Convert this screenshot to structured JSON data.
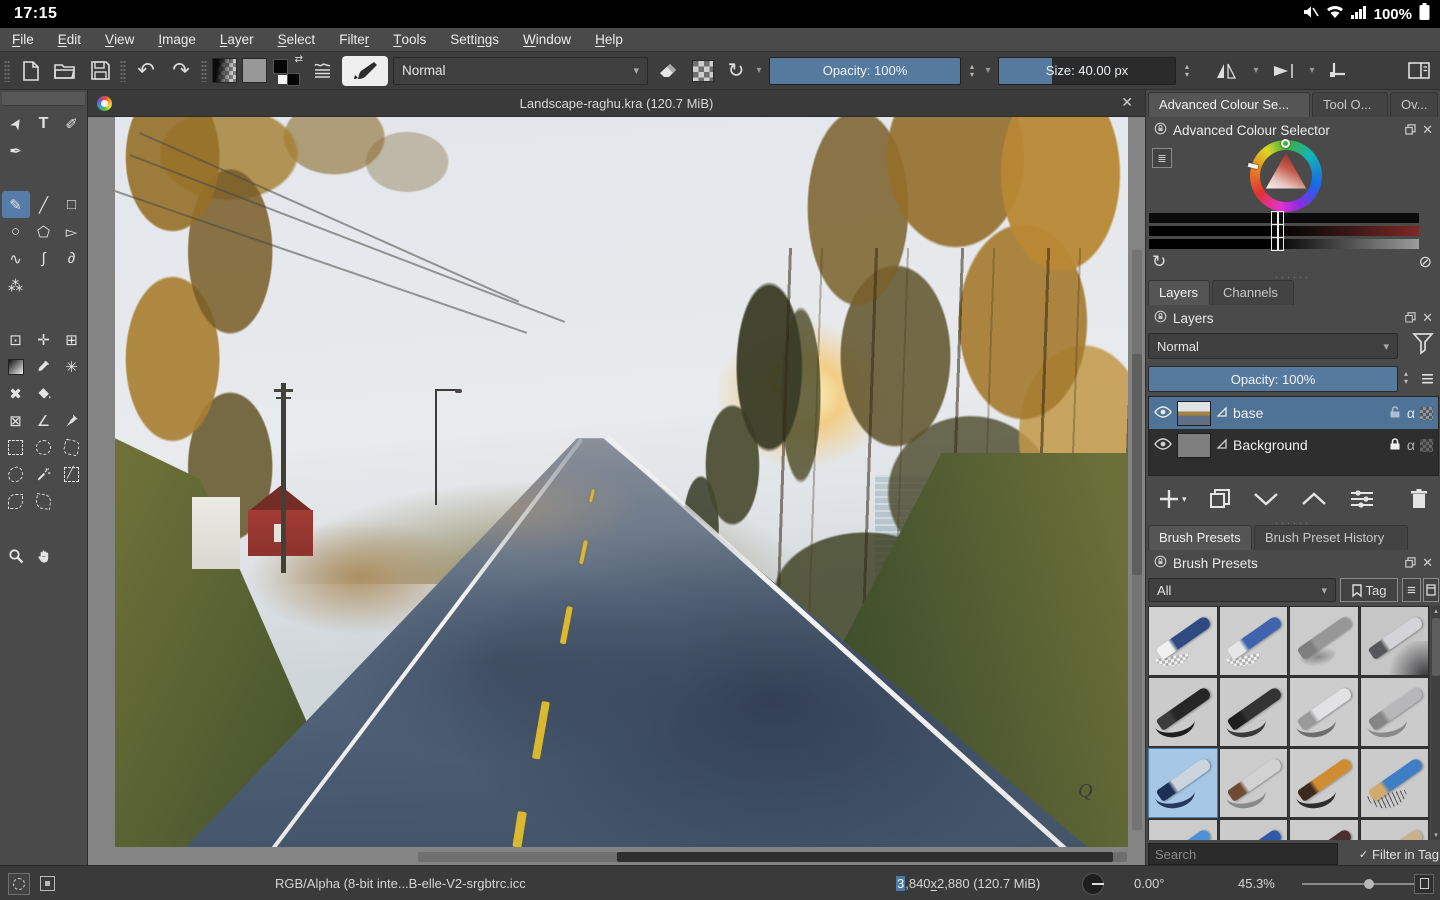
{
  "status_bar": {
    "time": "17:15",
    "battery": "100%"
  },
  "menu": {
    "items": [
      {
        "label": "File",
        "mnemonic": 0
      },
      {
        "label": "Edit",
        "mnemonic": 0
      },
      {
        "label": "View",
        "mnemonic": 0
      },
      {
        "label": "Image",
        "mnemonic": 0
      },
      {
        "label": "Layer",
        "mnemonic": 0
      },
      {
        "label": "Select",
        "mnemonic": 0
      },
      {
        "label": "Filter",
        "mnemonic": 5
      },
      {
        "label": "Tools",
        "mnemonic": 0
      },
      {
        "label": "Settings",
        "mnemonic": 5
      },
      {
        "label": "Window",
        "mnemonic": 0
      },
      {
        "label": "Help",
        "mnemonic": 0
      }
    ]
  },
  "toolbar": {
    "blending_mode": "Normal",
    "opacity_label": "Opacity: 100%",
    "opacity_fill": 1.0,
    "size_label": "Size: 40.00 px",
    "size_fill": 0.3
  },
  "document": {
    "title": "Landscape-raghu.kra (120.7 MiB)",
    "close": "✕",
    "signature": "Q"
  },
  "toolbox": {
    "tools": [
      {
        "name": "select-shapes-tool",
        "kind": "glyph",
        "glyph": "➤",
        "rot": -58
      },
      {
        "name": "text-tool",
        "kind": "glyph",
        "glyph": "T"
      },
      {
        "name": "edit-shapes-tool",
        "kind": "glyph",
        "glyph": "✐"
      },
      {
        "name": "calligraphy-tool",
        "kind": "glyph",
        "glyph": "✒"
      },
      {
        "kind": "blank"
      },
      {
        "kind": "blank"
      },
      {
        "kind": "gap"
      },
      {
        "name": "freehand-brush-tool",
        "kind": "glyph",
        "glyph": "✎",
        "selected": true
      },
      {
        "name": "line-tool",
        "kind": "glyph",
        "glyph": "╱"
      },
      {
        "name": "rectangle-tool",
        "kind": "glyph",
        "glyph": "□"
      },
      {
        "name": "ellipse-tool",
        "kind": "glyph",
        "glyph": "○"
      },
      {
        "name": "polygon-tool",
        "kind": "glyph",
        "glyph": "⬠"
      },
      {
        "name": "polyline-tool",
        "kind": "glyph",
        "glyph": "▻"
      },
      {
        "name": "bezier-curve-tool",
        "kind": "glyph",
        "glyph": "∿"
      },
      {
        "name": "freehand-path-tool",
        "kind": "glyph",
        "glyph": "∫"
      },
      {
        "name": "dynamic-brush-tool",
        "kind": "glyph",
        "glyph": "∂"
      },
      {
        "name": "multibrush-tool",
        "kind": "glyph",
        "glyph": "⁂"
      },
      {
        "kind": "blank"
      },
      {
        "kind": "blank"
      },
      {
        "kind": "gap"
      },
      {
        "name": "transform-tool",
        "kind": "glyph",
        "glyph": "⊡"
      },
      {
        "name": "move-tool",
        "kind": "glyph",
        "glyph": "✛"
      },
      {
        "name": "crop-tool",
        "kind": "glyph",
        "glyph": "⊞"
      },
      {
        "name": "gradient-tool",
        "kind": "css",
        "css": "tb-gradient"
      },
      {
        "name": "color-sampler-tool",
        "kind": "svg",
        "svg": "dropper"
      },
      {
        "name": "smart-patch-tool",
        "kind": "glyph",
        "glyph": "✳"
      },
      {
        "name": "colorize-mask-tool",
        "kind": "glyph",
        "glyph": "✖"
      },
      {
        "name": "fill-tool",
        "kind": "svg",
        "svg": "bucket"
      },
      {
        "kind": "blank"
      },
      {
        "name": "assistants-tool",
        "kind": "glyph",
        "glyph": "⊠"
      },
      {
        "name": "measure-tool",
        "kind": "glyph",
        "glyph": "∠"
      },
      {
        "name": "reference-images-tool",
        "kind": "svg",
        "svg": "pin"
      },
      {
        "name": "rectangular-selection-tool",
        "kind": "css",
        "css": "selicon"
      },
      {
        "name": "elliptical-selection-tool",
        "kind": "css",
        "css": "selicon sel-ellipse"
      },
      {
        "name": "polygonal-selection-tool",
        "kind": "css",
        "css": "selicon sel-poly"
      },
      {
        "name": "freehand-selection-tool",
        "kind": "css",
        "css": "selicon sel-outline"
      },
      {
        "name": "similar-color-selection-tool",
        "kind": "svg",
        "svg": "wand"
      },
      {
        "name": "enclose-fill-tool",
        "kind": "css",
        "css": "selicon sel-enclose"
      },
      {
        "name": "bezier-selection-tool",
        "kind": "css",
        "css": "selicon sel-bezier"
      },
      {
        "name": "magnetic-selection-tool",
        "kind": "css",
        "css": "selicon sel-magnetic"
      },
      {
        "kind": "blank"
      },
      {
        "kind": "gap"
      },
      {
        "name": "zoom-tool",
        "kind": "svg",
        "svg": "magnifier"
      },
      {
        "name": "pan-tool",
        "kind": "svg",
        "svg": "hand"
      }
    ]
  },
  "right_panel": {
    "dock_tabs": [
      {
        "label": "Advanced Colour Se...",
        "active": true
      },
      {
        "label": "Tool O...",
        "active": false
      },
      {
        "label": "Ov...",
        "active": false
      }
    ],
    "color_selector": {
      "title": "Advanced Colour Selector"
    },
    "layers": {
      "tabs": [
        {
          "label": "Layers",
          "active": true
        },
        {
          "label": "Channels",
          "active": false
        }
      ],
      "title": "Layers",
      "blending_mode": "Normal",
      "opacity_label": "Opacity:  100%",
      "rows": [
        {
          "name": "base",
          "selected": true,
          "locked": false
        },
        {
          "name": "Background",
          "selected": false,
          "locked": true
        }
      ]
    },
    "brush_presets": {
      "tabs": [
        {
          "label": "Brush Presets",
          "active": true
        },
        {
          "label": "Brush Preset History",
          "active": false
        }
      ],
      "title": "Brush Presets",
      "tag_filter": "All",
      "tag_button": "Tag",
      "search_placeholder": "Search",
      "filter_label": "Filter in Tag",
      "brushes": [
        {
          "name": "eraser-large",
          "cell": "#d2d2d2",
          "tip": "#f1f1f1",
          "handle": "#2e4a80",
          "stroke": "checker"
        },
        {
          "name": "eraser-small",
          "cell": "#cecece",
          "tip": "#e6e6e6",
          "handle": "#3f63ad",
          "stroke": "checker"
        },
        {
          "name": "blender-soft",
          "cell": "#cccccc",
          "tip": "#7e7e7e",
          "handle": "#979797",
          "stroke": "soft"
        },
        {
          "name": "airbrush-pen",
          "cell": "#c6c6c6",
          "tip": "#55565a",
          "handle": "#d4d4d8",
          "stroke": "shade"
        },
        {
          "name": "ink-pen-black",
          "cell": "#cbcbcb",
          "tip": "#3c3c3c",
          "handle": "#262626",
          "stroke": "#1d1d1d"
        },
        {
          "name": "marker-black",
          "cell": "#cbcbcb",
          "tip": "#1f1f1f",
          "handle": "#333333",
          "stroke": "#3a3a3a"
        },
        {
          "name": "fineliner-silver",
          "cell": "#cdcdcd",
          "tip": "#9a9a9a",
          "handle": "#e2e2e4",
          "stroke": "#6e6e6e"
        },
        {
          "name": "pen-gray",
          "cell": "#cbcbcb",
          "tip": "#858585",
          "handle": "#b7b7ba",
          "stroke": "#8a8a8a"
        },
        {
          "name": "paintbrush-wet",
          "cell": "#a6c8e6",
          "selected": true,
          "tip": "#1c2f55",
          "handle": "#ccd4de",
          "stroke": "#24385e"
        },
        {
          "name": "round-brush",
          "cell": "#cccccc",
          "tip": "#6e4b32",
          "handle": "#d2d2d2",
          "stroke": "#8a8a8a"
        },
        {
          "name": "dip-pen-orange",
          "cell": "#cdcdcd",
          "tip": "#3c2a1e",
          "handle": "#cf8c33",
          "stroke": "#2e2e2e"
        },
        {
          "name": "pencil-blue",
          "cell": "#cbcbcb",
          "tip": "#d2aa6e",
          "handle": "#3e7ec4",
          "stroke": "hatch"
        },
        {
          "name": "pencil-blue-2",
          "cell": "#cccccc",
          "tip": "#cfae78",
          "handle": "#4a90d9",
          "stroke": "#888888"
        },
        {
          "name": "pen-blue",
          "cell": "#cbcbcb",
          "tip": "#cccccc",
          "handle": "#2d59a8",
          "stroke": "#444444"
        },
        {
          "name": "marker-dark-red",
          "cell": "#cccccc",
          "tip": "#202020",
          "handle": "#4a3034",
          "stroke": "#333333"
        },
        {
          "name": "pencil-tan",
          "cell": "#cbcbcb",
          "tip": "#8a7a5a",
          "handle": "#c8b18c",
          "stroke": "#999999"
        }
      ]
    }
  },
  "status_bottom": {
    "profile": "RGB/Alpha (8-bit inte...B-elle-V2-srgbtrc.icc",
    "dim_hl": "3",
    "dim_mid": ",840 ",
    "dim_x": "x",
    "dim_rest": " 2,880 (120.7 MiB)",
    "angle": "0.00°",
    "zoom": "45.3%",
    "zoom_fill": 0.55
  },
  "icons": {
    "undo": "↶",
    "redo": "↷",
    "reload": "↻",
    "dropdown": "▾",
    "spin_up": "▴",
    "spin_down": "▾",
    "close": "✕",
    "alpha": "α",
    "check": "✓",
    "menu": "≡",
    "settings_list": "≣",
    "no_color": "⊘",
    "swap": "⇄",
    "divider_dots": "······"
  },
  "accent_colors": {
    "slider_blue": "#56799e",
    "layer_selected": "#4e7397",
    "preset_selected": "#a6c8e6"
  }
}
